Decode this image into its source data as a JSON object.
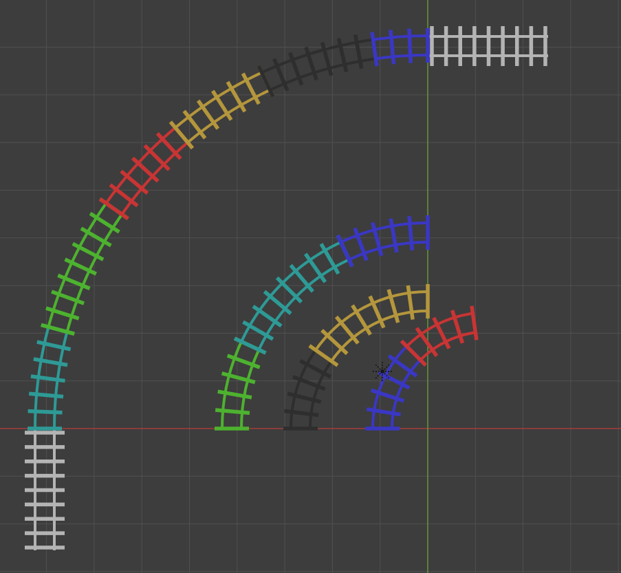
{
  "viewport": {
    "background": "#3d3d3d",
    "grid_minor_color": "#474747",
    "grid_major_color": "#505050",
    "axis_x_color": "#b83c3c",
    "axis_y_color": "#6aa53a",
    "outline_color": "#5a5a5a"
  },
  "colors": {
    "white": "#b4b4b4",
    "teal": "#2e9a96",
    "green": "#4db22f",
    "red": "#c93434",
    "yellow": "#b4963c",
    "dark": "#2e2e2e",
    "blue": "#3a37c4"
  },
  "objects": [
    {
      "name": "straight-track-bottom-left",
      "kind": "straight",
      "color": "white",
      "orientation": "vertical"
    },
    {
      "name": "straight-track-top-right",
      "kind": "straight",
      "color": "white",
      "orientation": "horizontal"
    },
    {
      "name": "large-curve-segment-teal",
      "kind": "curve",
      "ring": "large",
      "color": "teal"
    },
    {
      "name": "large-curve-segment-green",
      "kind": "curve",
      "ring": "large",
      "color": "green"
    },
    {
      "name": "large-curve-segment-red",
      "kind": "curve",
      "ring": "large",
      "color": "red"
    },
    {
      "name": "large-curve-segment-yellow",
      "kind": "curve",
      "ring": "large",
      "color": "yellow"
    },
    {
      "name": "large-curve-segment-dark",
      "kind": "curve",
      "ring": "large",
      "color": "dark"
    },
    {
      "name": "large-curve-segment-blue",
      "kind": "curve",
      "ring": "large",
      "color": "blue"
    },
    {
      "name": "medium-curve-segment-green",
      "kind": "curve",
      "ring": "medium",
      "color": "green"
    },
    {
      "name": "medium-curve-segment-teal",
      "kind": "curve",
      "ring": "medium",
      "color": "teal"
    },
    {
      "name": "medium-curve-segment-blue",
      "kind": "curve",
      "ring": "medium",
      "color": "blue"
    },
    {
      "name": "small-curve-segment-dark",
      "kind": "curve",
      "ring": "small",
      "color": "dark"
    },
    {
      "name": "small-curve-segment-yellow",
      "kind": "curve",
      "ring": "small",
      "color": "yellow"
    },
    {
      "name": "tiny-curve-segment-blue",
      "kind": "curve",
      "ring": "tiny",
      "color": "blue"
    },
    {
      "name": "tiny-curve-segment-red",
      "kind": "curve",
      "ring": "tiny",
      "color": "red"
    }
  ]
}
